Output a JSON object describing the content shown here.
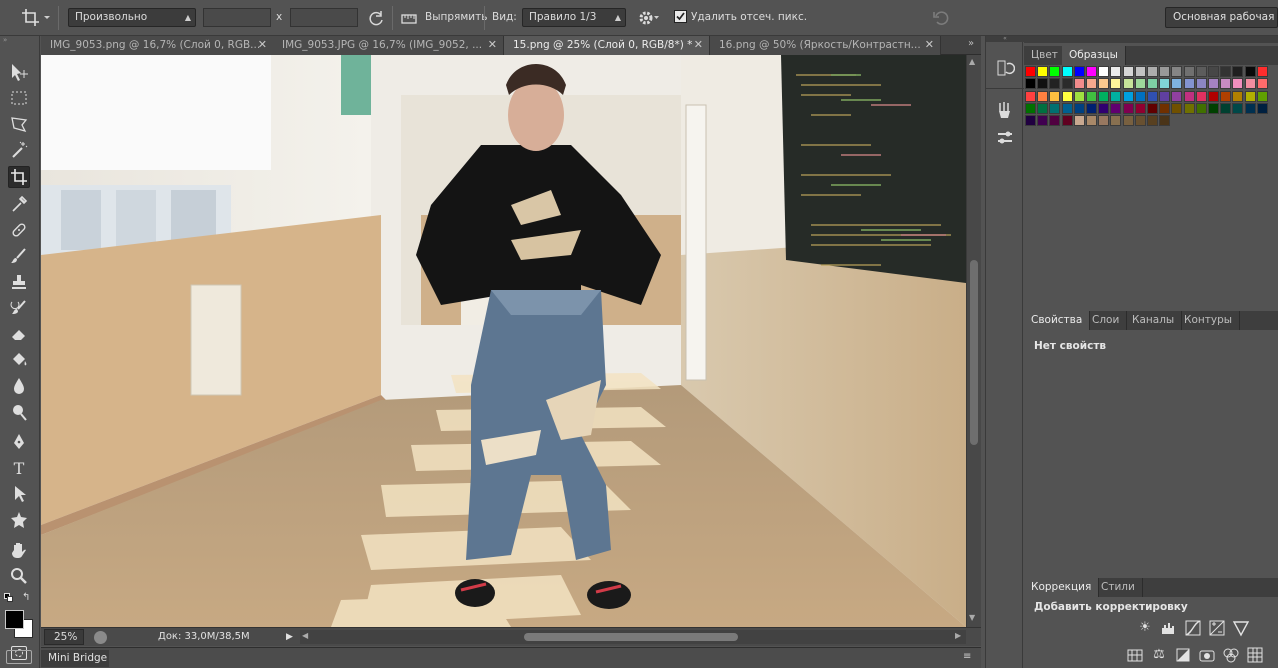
{
  "options_bar": {
    "ratio_select": "Произвольно",
    "swap_symbol": "x",
    "straighten_label": "Выпрямить",
    "view_label": "Вид:",
    "view_select": "Правило 1/3",
    "delete_cropped_label": "Удалить отсеч. пикс.",
    "delete_cropped_checked": true,
    "workspace_label": "Основная рабочая сред"
  },
  "tabs": [
    {
      "label": "IMG_9053.png @ 16,7% (Слой 0, RGB...",
      "active": false
    },
    {
      "label": "IMG_9053.JPG @ 16,7% (IMG_9052, ...",
      "active": false
    },
    {
      "label": "15.png @ 25% (Слой 0, RGB/8*) *",
      "active": true
    },
    {
      "label": "16.png @ 50% (Яркость/Контрастн...",
      "active": false
    }
  ],
  "status": {
    "zoom": "25%",
    "doc": "Док: 33,0M/38,5M"
  },
  "mini_bridge": "Mini Bridge",
  "panels": {
    "color_tabs": [
      "Цвет",
      "Образцы"
    ],
    "properties_tabs": [
      "Свойства",
      "Слои",
      "Каналы",
      "Контуры"
    ],
    "properties_text": "Нет свойств",
    "adjust_tabs": [
      "Коррекция",
      "Стили"
    ],
    "adjust_title": "Добавить корректировку"
  },
  "swatches": [
    [
      "#ff0000",
      "#ffff00",
      "#00ff00",
      "#00ffff",
      "#0000ff",
      "#ff00ff",
      "#ffffff",
      "#ebebeb",
      "#d6d6d6",
      "#c2c2c2",
      "#adadad",
      "#999999",
      "#858585",
      "#707070",
      "#5c5c5c",
      "#474747",
      "#333333",
      "#1f1f1f",
      "#0a0a0a",
      "#ff2d2d"
    ],
    [
      "#000000",
      "#111111",
      "#222222",
      "#2b2b2b",
      "#f28c8c",
      "#f7a98e",
      "#fbc98f",
      "#fff59a",
      "#c7e39a",
      "#9ed89b",
      "#7ecfa4",
      "#80d3d6",
      "#7fb3e0",
      "#8393cf",
      "#8c86c3",
      "#a582c1",
      "#c88bc3",
      "#f08fbd",
      "#f28ea0",
      "#ff6b6b"
    ],
    [
      "#ff4040",
      "#ff8040",
      "#ffc040",
      "#ffff40",
      "#a0e040",
      "#40c040",
      "#00b060",
      "#00b0a0",
      "#00a0e0",
      "#0070c0",
      "#3050b0",
      "#6040a0",
      "#9040a0",
      "#c03080",
      "#e03060",
      "#b00000",
      "#b04000",
      "#b08000",
      "#b0b000",
      "#60a000"
    ],
    [
      "#007000",
      "#007040",
      "#007070",
      "#006090",
      "#004080",
      "#002070",
      "#300070",
      "#600070",
      "#800050",
      "#900030",
      "#600000",
      "#703000",
      "#705000",
      "#707000",
      "#407000",
      "#004000",
      "#004030",
      "#004848",
      "#003050",
      "#002040"
    ],
    [
      "#200040",
      "#400050",
      "#500040",
      "#600020",
      "#c8a890",
      "#a88868",
      "#987860",
      "#887050",
      "#786040",
      "#685030",
      "#584020",
      "#4a3418"
    ]
  ]
}
